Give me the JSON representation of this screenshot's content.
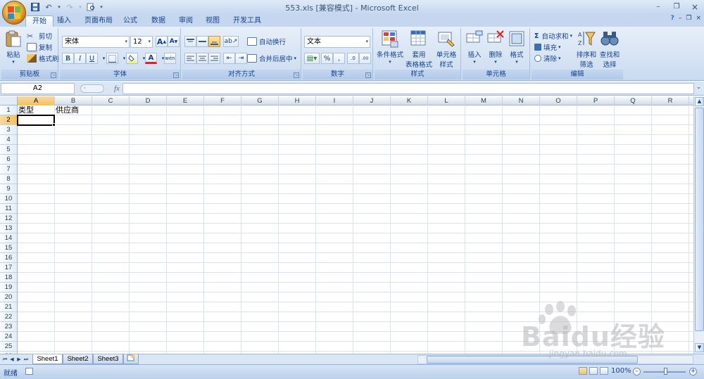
{
  "window": {
    "title": "553.xls  [兼容模式] - Microsoft Excel"
  },
  "qat": {
    "icons": [
      "save-icon",
      "undo-icon",
      "redo-icon",
      "print-preview-icon",
      "customize-icon"
    ]
  },
  "tabs": [
    {
      "label": "开始",
      "active": true
    },
    {
      "label": "插入"
    },
    {
      "label": "页面布局"
    },
    {
      "label": "公式"
    },
    {
      "label": "数据"
    },
    {
      "label": "审阅"
    },
    {
      "label": "视图"
    },
    {
      "label": "开发工具"
    }
  ],
  "ribbon": {
    "clipboard": {
      "label": "剪贴板",
      "paste": "粘贴",
      "cut": "剪切",
      "copy": "复制",
      "format_painter": "格式刷"
    },
    "font": {
      "label": "字体",
      "font_name": "宋体",
      "font_size": "12",
      "bold": "B",
      "italic": "I",
      "underline": "U",
      "grow": "A",
      "shrink": "A",
      "font_color_letter": "A",
      "phonetic": "wén"
    },
    "alignment": {
      "label": "对齐方式",
      "wrap_text": "自动换行",
      "merge_center": "合并后居中"
    },
    "number": {
      "label": "数字",
      "format": "文本",
      "percent": "%",
      "comma": ",",
      "inc_decimal": ".0",
      "dec_decimal": ".00"
    },
    "styles": {
      "label": "样式",
      "conditional_1": "条件格式",
      "table_1": "套用",
      "table_2": "表格格式",
      "cell_1": "单元格",
      "cell_2": "样式"
    },
    "cells": {
      "label": "单元格",
      "insert": "插入",
      "delete": "删除",
      "format": "格式"
    },
    "editing": {
      "label": "编辑",
      "autosum_symbol": "Σ",
      "autosum": "自动求和",
      "fill": "填充",
      "clear": "清除",
      "sort_1": "排序和",
      "sort_2": "筛选",
      "find_1": "查找和",
      "find_2": "选择"
    }
  },
  "formula_bar": {
    "name_box": "A2",
    "fx": "fx",
    "formula": ""
  },
  "sheet": {
    "columns": [
      "A",
      "B",
      "C",
      "D",
      "E",
      "F",
      "G",
      "H",
      "I",
      "J",
      "K",
      "L",
      "M",
      "N",
      "O",
      "P",
      "Q",
      "R"
    ],
    "selected_column": "A",
    "rows": [
      "1",
      "2",
      "3",
      "4",
      "5",
      "6",
      "7",
      "8",
      "9",
      "10",
      "11",
      "12",
      "13",
      "14",
      "15",
      "16",
      "17",
      "18",
      "19",
      "20",
      "21",
      "22",
      "23",
      "24",
      "25",
      "26"
    ],
    "selected_row": "2",
    "cells": [
      {
        "ref": "A1",
        "value": "类型"
      },
      {
        "ref": "B1",
        "value": "供应商"
      }
    ],
    "active_cell": "A2"
  },
  "sheet_tabs": [
    {
      "label": "Sheet1",
      "active": true
    },
    {
      "label": "Sheet2"
    },
    {
      "label": "Sheet3"
    }
  ],
  "status": {
    "ready": "就绪",
    "zoom": "100%"
  },
  "watermark": {
    "text": "Baidu经验",
    "url": "jingyan.baidu.com"
  },
  "colors": {
    "accent": "#15428b",
    "ribbon_bg": "#d6e3f3",
    "selected_header": "#f1c15f"
  }
}
